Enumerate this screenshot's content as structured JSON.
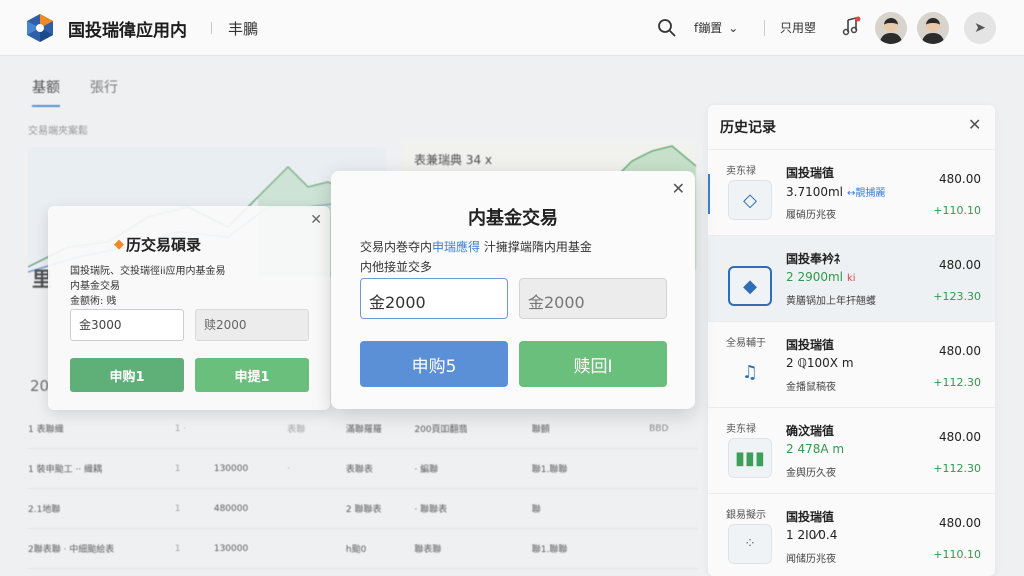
{
  "header": {
    "app_title": "国投瑞徫应用内",
    "nav_link": "丰鵩",
    "dropdown_label": "f鏰置",
    "link2": "只用曌"
  },
  "background": {
    "tabs": [
      "基额",
      "張行"
    ],
    "section_label": "交易端夾案鬆",
    "chart2_title": "表兼瑞典 34 ⅹ",
    "year_label": "20",
    "big_char": "里",
    "table_rows": [
      [
        "1 表聯織",
        "1 ·",
        "",
        "表聯",
        "滿聯羅羅",
        "200頁吅翻翡",
        "聯顫",
        "BBD"
      ],
      [
        "1 裝申颱工 ·· 織耦",
        "1",
        "130000",
        "·",
        "表聯表",
        "· 編聯",
        "聯1.聯聯",
        ""
      ],
      [
        "2.1地聯",
        "1",
        "480000",
        "",
        "2 聯聯表",
        "· 聯聯表",
        "聯",
        ""
      ],
      [
        "2聯表聯 · 中細颱絵表",
        "1",
        "130000",
        "",
        "h颱0",
        "聯表聯",
        "聯1.聯聯",
        ""
      ]
    ]
  },
  "history_panel": {
    "title": "历史记录",
    "items": [
      {
        "tag": "卖东禄",
        "icon": "book-icon",
        "name": "国投瑞徝",
        "sub": "3.7100ml",
        "sub_hl": "↔靚捕麗",
        "desc": "履硝历兆夜",
        "amount": "480.00",
        "change": "+110.10"
      },
      {
        "tag": "",
        "icon": "diamond-icon",
        "name": "国投奉衿ﾈ",
        "sub": "2 2900ml",
        "sub_hl": "ki",
        "desc": "黄膳锅加上年扞翹蠖",
        "amount": "480.00",
        "change": "+123.30"
      },
      {
        "tag": "全易輔于",
        "icon": "music-note-icon",
        "name": "国投瑞徝",
        "sub": "2 ℚ100X m",
        "sub_hl": "",
        "desc": "金播鼠稿夜",
        "amount": "480.00",
        "change": "+112.30"
      },
      {
        "tag": "卖东禄",
        "icon": "audio-wave-icon",
        "name": "确汶瑞徝",
        "sub": "2 478A m",
        "sub_hl": "",
        "desc": "金舆历久夜",
        "amount": "480.00",
        "change": "+112.30"
      },
      {
        "tag": "銀易擬示",
        "icon": "dots-icon",
        "name": "国投瑞徝",
        "sub": "1 2Ⅰ0⁄0.4",
        "sub_hl": "",
        "desc": "闻储历兆夜",
        "amount": "480.00",
        "change": "+110.10"
      }
    ]
  },
  "small_modal": {
    "title": "历交易碩录",
    "text_line1": "国投瑞阮、交投瑞徑ii应用内基金易",
    "text_line2": "内基金交易",
    "text_line3": "金额術:  贱 ",
    "input1": "金3000",
    "input2": "赎2000",
    "buy_label": "申购1",
    "redeem_label": "申提1"
  },
  "main_modal": {
    "title": "内基金交易",
    "text_a": "交易内巻夺内",
    "text_link": "申瑞應得",
    "text_b": " 汁擁撑端隋内用基金",
    "text_line2": "内他接並交多",
    "input_value": "金2000",
    "input_disabled_value": "金2000",
    "buy_label": "申购5",
    "redeem_label": "赎回I"
  },
  "colors": {
    "primary_blue": "#5b8fd6",
    "green": "#6bbf7c",
    "green_dark": "#5faf78"
  }
}
